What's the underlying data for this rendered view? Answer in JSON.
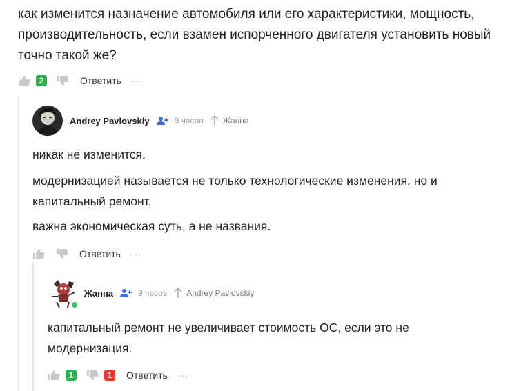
{
  "top_comment": {
    "lines": [
      "как изменится назначение автомобиля или его характеристики, мощность,",
      "производительность, если взамен испорченного двигателя установить новый",
      "точно такой же?"
    ],
    "likes": "2",
    "reply_label": "Ответить",
    "more": "···"
  },
  "reply1": {
    "author": "Andrey Pavlovskiy",
    "time": "9 часов",
    "reply_to": "Жанна",
    "paragraphs": [
      "никак не изменится.",
      "модернизацией называется не только технологические изменения, но и",
      "капитальный ремонт.",
      "важна экономическая суть, а не названия."
    ],
    "reply_label": "Ответить",
    "more": "···"
  },
  "reply2": {
    "author": "Жанна",
    "time": "9 часов",
    "reply_to": "Andrey Pavlovskiy",
    "lines": [
      "капитальный ремонт не увеличивает стоимость ОС, если это не",
      "модернизация."
    ],
    "likes": "1",
    "dislikes": "1",
    "reply_label": "Ответить",
    "more": "···"
  },
  "colors": {
    "like_badge": "#2bb24c",
    "dislike_badge": "#e8392f",
    "online_dot": "#35c759",
    "follow_icon": "#3b6fe0"
  }
}
